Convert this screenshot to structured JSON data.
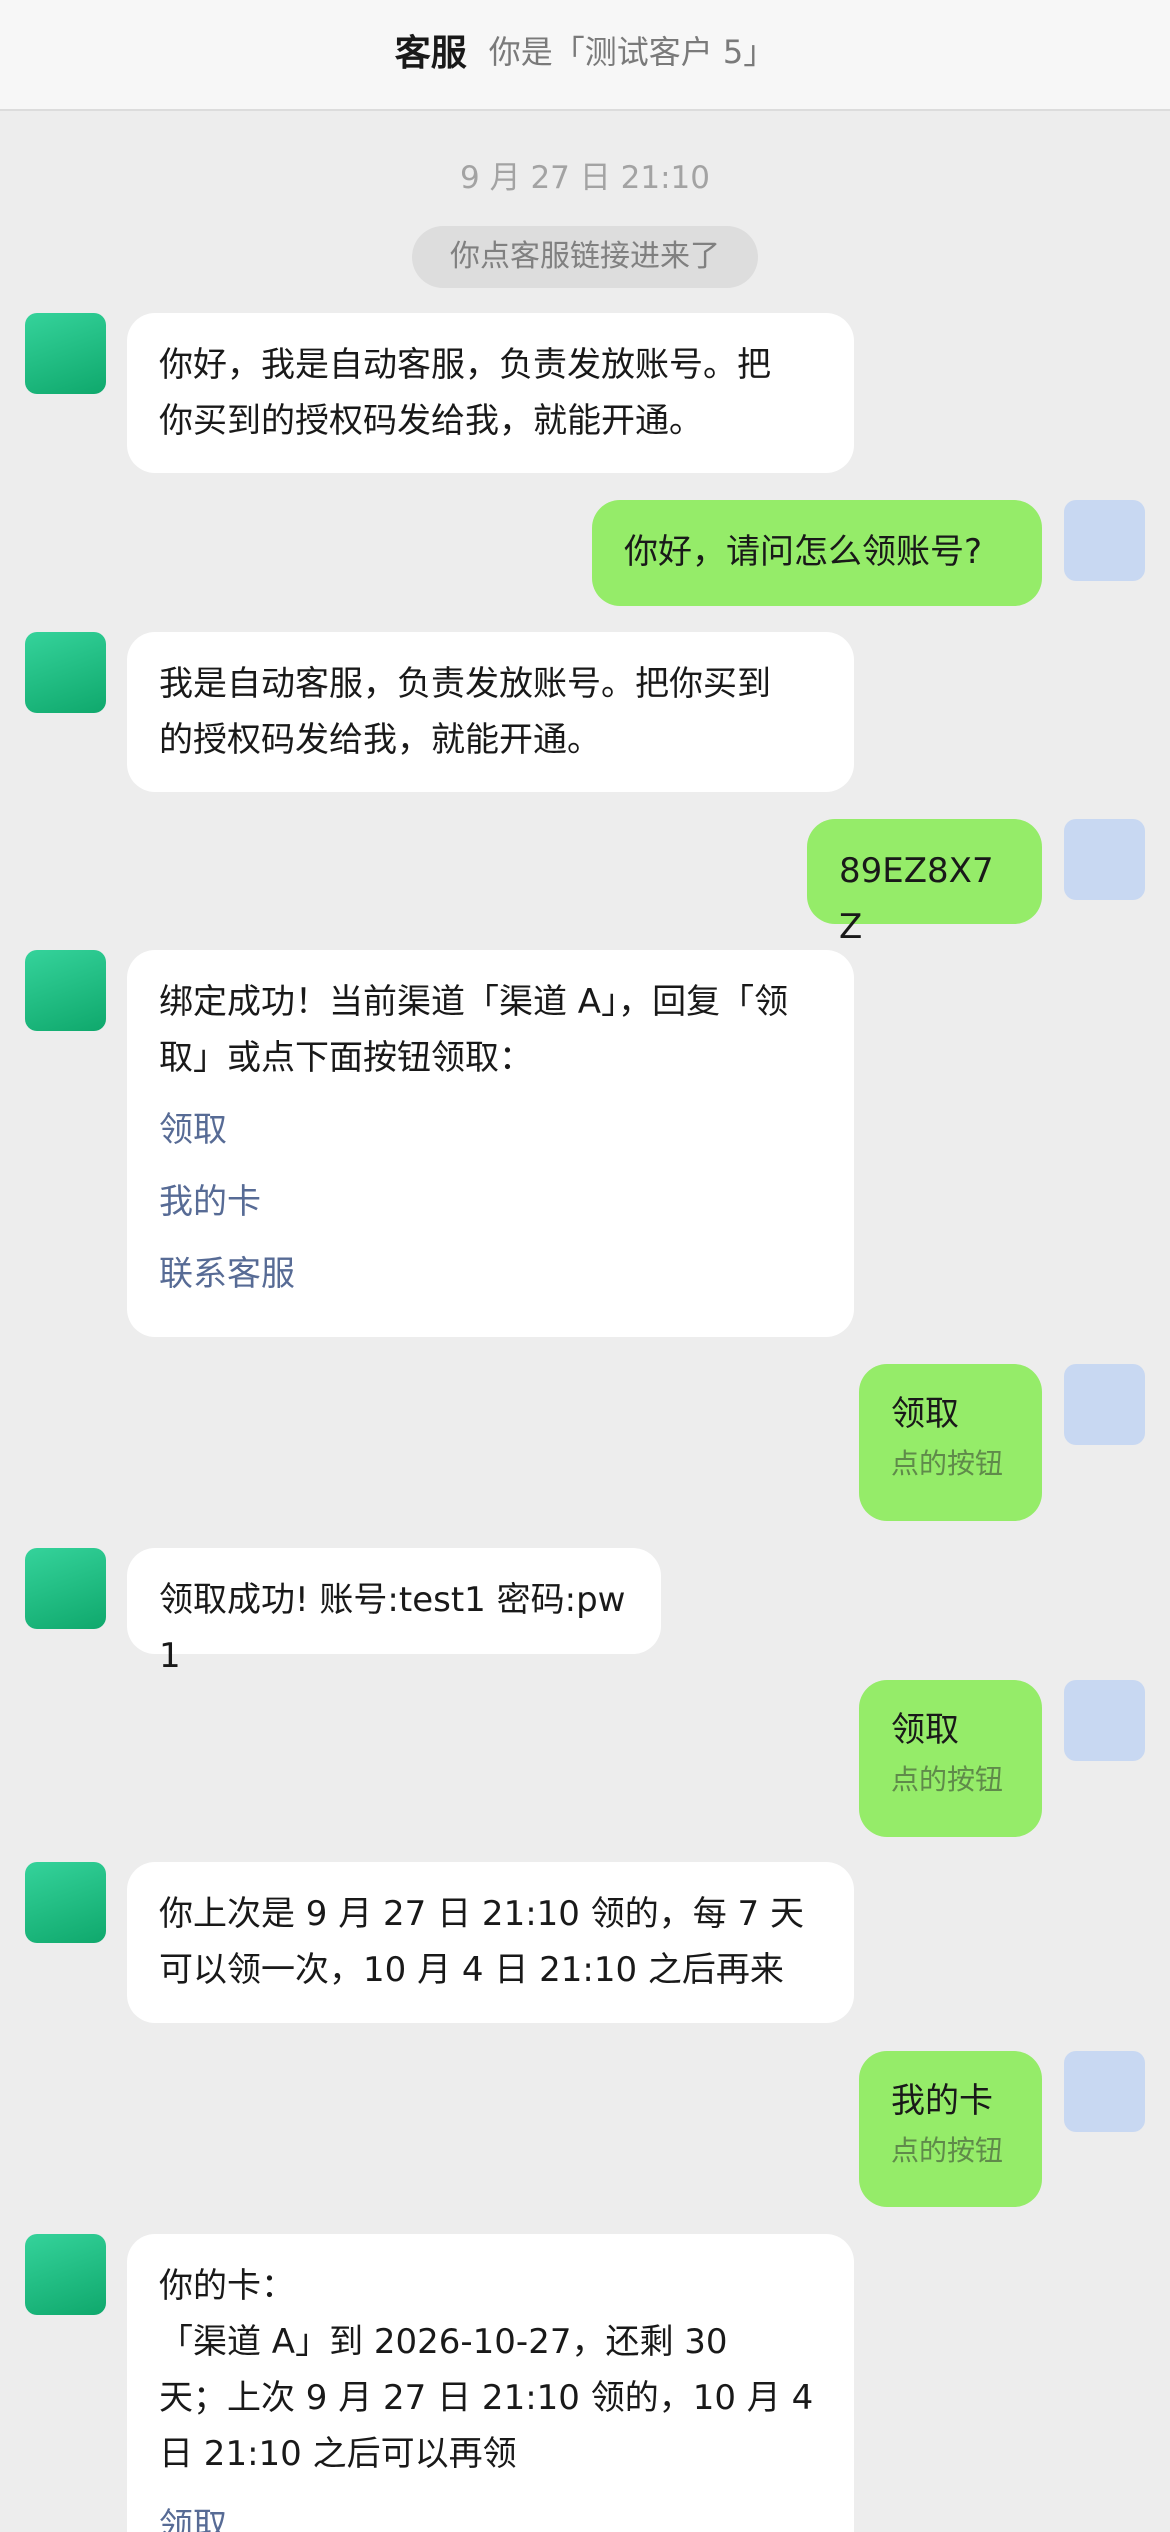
{
  "header": {
    "title": "客服",
    "subtitle": "你是「测试客户 5」"
  },
  "time_separator": "9 月 27 日 21:10",
  "system_notice": "你点客服链接进来了",
  "messages": {
    "m1": {
      "lines": [
        "你好，我是自动客服，负责发放账号。把",
        "你买到的授权码发给我，就能开通。"
      ]
    },
    "m2": {
      "text": "你好，请问怎么领账号?"
    },
    "m3": {
      "lines": [
        "我是自动客服，负责发放账号。把你买到",
        "的授权码发给我，就能开通。"
      ]
    },
    "m4": {
      "text": "89EZ8X7Z"
    },
    "m5": {
      "lines": [
        "绑定成功！当前渠道「渠道 A」，回复「领",
        "取」或点下面按钮领取："
      ],
      "links": [
        "领取",
        "我的卡",
        "联系客服"
      ]
    },
    "m6": {
      "text": "领取",
      "hint": "点的按钮"
    },
    "m7": {
      "text": "领取成功! 账号:test1 密码:pw1"
    },
    "m8": {
      "text": "领取",
      "hint": "点的按钮"
    },
    "m9": {
      "lines": [
        "你上次是 9 月 27 日 21:10 领的，每 7 天",
        "可以领一次，10 月 4 日 21:10 之后再来"
      ]
    },
    "m10": {
      "text": "我的卡",
      "hint": "点的按钮"
    },
    "m11": {
      "lines": [
        "你的卡：",
        "「渠道 A」到 2026-10-27，还剩 30",
        "天；上次 9 月 27 日 21:10 领的，10 月 4",
        "日 21:10 之后可以再领"
      ],
      "links": [
        "领取"
      ]
    }
  },
  "colors": {
    "background": "#ededed",
    "bot_bubble": "#ffffff",
    "user_bubble": "#95ec69",
    "link": "#576b95"
  }
}
